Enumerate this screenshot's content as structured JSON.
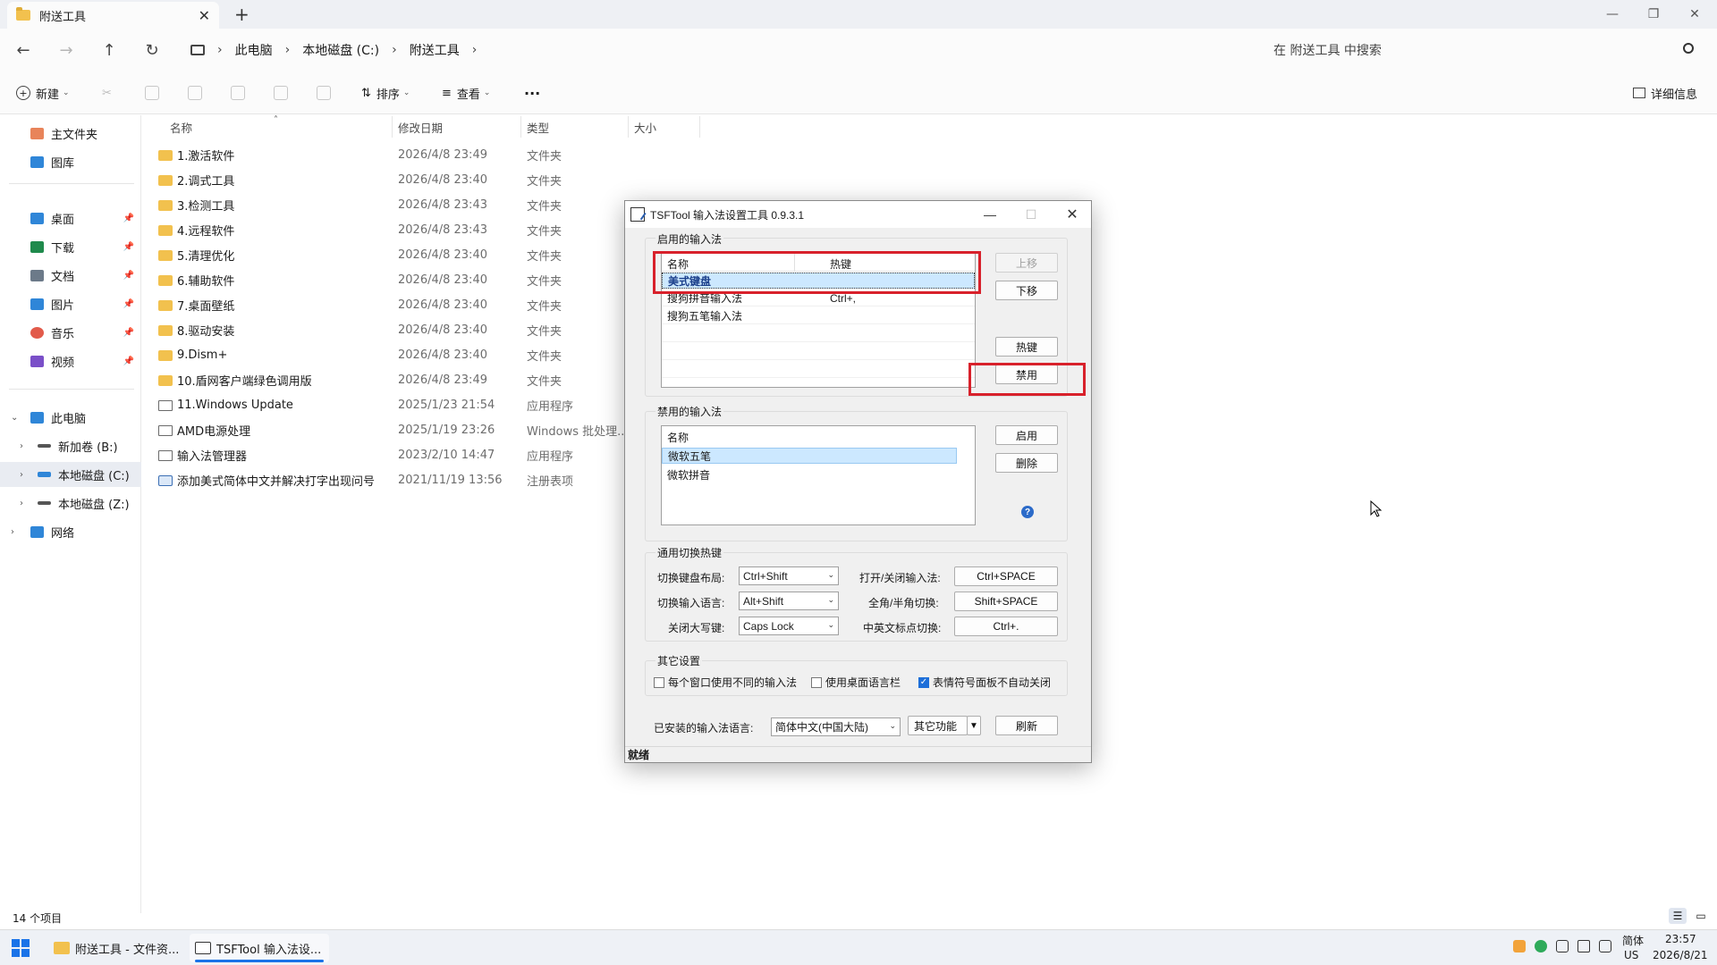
{
  "window": {
    "tab_title": "附送工具",
    "close_glyph": "✕",
    "new_tab_glyph": "+"
  },
  "nav": {
    "breadcrumb": [
      "此电脑",
      "本地磁盘 (C:)",
      "附送工具"
    ],
    "search_placeholder": "在 附送工具 中搜索"
  },
  "toolbar": {
    "new_label": "新建",
    "sort_label": "排序",
    "view_label": "查看",
    "more_label": "···",
    "details_label": "详细信息"
  },
  "sidebar": {
    "home": "主文件夹",
    "gallery": "图库",
    "quick": [
      {
        "label": "桌面",
        "icon": "desktop-icon",
        "color": "#2f86d8"
      },
      {
        "label": "下载",
        "icon": "download-icon",
        "color": "#1f8a4c"
      },
      {
        "label": "文档",
        "icon": "document-icon",
        "color": "#6c7a89"
      },
      {
        "label": "图片",
        "icon": "pictures-icon",
        "color": "#2f86d8"
      },
      {
        "label": "音乐",
        "icon": "music-icon",
        "color": "#e25b4b"
      },
      {
        "label": "视频",
        "icon": "video-icon",
        "color": "#7a4fc8"
      }
    ],
    "this_pc": "此电脑",
    "drives": [
      "新加卷 (B:)",
      "本地磁盘 (C:)",
      "本地磁盘 (Z:)"
    ],
    "network": "网络"
  },
  "columns": {
    "name": "名称",
    "modified": "修改日期",
    "type": "类型",
    "size": "大小"
  },
  "files": [
    {
      "name": "1.激活软件",
      "date": "2026/4/8 23:49",
      "type": "文件夹",
      "kind": "folder"
    },
    {
      "name": "2.调式工具",
      "date": "2026/4/8 23:40",
      "type": "文件夹",
      "kind": "folder"
    },
    {
      "name": "3.检测工具",
      "date": "2026/4/8 23:43",
      "type": "文件夹",
      "kind": "folder"
    },
    {
      "name": "4.远程软件",
      "date": "2026/4/8 23:43",
      "type": "文件夹",
      "kind": "folder"
    },
    {
      "name": "5.清理优化",
      "date": "2026/4/8 23:40",
      "type": "文件夹",
      "kind": "folder"
    },
    {
      "name": "6.辅助软件",
      "date": "2026/4/8 23:40",
      "type": "文件夹",
      "kind": "folder"
    },
    {
      "name": "7.桌面壁纸",
      "date": "2026/4/8 23:40",
      "type": "文件夹",
      "kind": "folder"
    },
    {
      "name": "8.驱动安装",
      "date": "2026/4/8 23:40",
      "type": "文件夹",
      "kind": "folder"
    },
    {
      "name": "9.Dism+",
      "date": "2026/4/8 23:40",
      "type": "文件夹",
      "kind": "folder"
    },
    {
      "name": "10.盾网客户端绿色调用版",
      "date": "2026/4/8 23:49",
      "type": "文件夹",
      "kind": "folder"
    },
    {
      "name": "11.Windows Update",
      "date": "2025/1/23 21:54",
      "type": "应用程序",
      "kind": "app"
    },
    {
      "name": "AMD电源处理",
      "date": "2025/1/19 23:26",
      "type": "Windows 批处理...",
      "kind": "app"
    },
    {
      "name": "输入法管理器",
      "date": "2023/2/10 14:47",
      "type": "应用程序",
      "kind": "app"
    },
    {
      "name": "添加美式简体中文并解决打字出现问号",
      "date": "2021/11/19 13:56",
      "type": "注册表项",
      "kind": "reg"
    }
  ],
  "status": {
    "item_count": "14 个项目"
  },
  "dialog": {
    "title": "TSFTool 输入法设置工具 0.9.3.1",
    "enabled_group": "启用的输入法",
    "enabled_cols": {
      "name": "名称",
      "hotkey": "热键"
    },
    "enabled_items": [
      {
        "name": "美式键盘",
        "hotkey": ""
      },
      {
        "name": "搜狗拼音输入法",
        "hotkey": "Ctrl+,"
      },
      {
        "name": "搜狗五笔输入法",
        "hotkey": ""
      }
    ],
    "btn_up": "上移",
    "btn_down": "下移",
    "btn_hotkey": "热键",
    "btn_disable": "禁用",
    "disabled_group": "禁用的输入法",
    "disabled_col": "名称",
    "disabled_items": [
      "微软五笔",
      "微软拼音"
    ],
    "btn_enable": "启用",
    "btn_delete": "删除",
    "help_glyph": "?",
    "hotkeys_group": "通用切换热键",
    "hk_layout_label": "切换键盘布局:",
    "hk_layout_value": "Ctrl+Shift",
    "hk_lang_label": "切换输入语言:",
    "hk_lang_value": "Alt+Shift",
    "hk_caps_label": "关闭大写键:",
    "hk_caps_value": "Caps Lock",
    "hk_toggle_label": "打开/关闭输入法:",
    "hk_toggle_value": "Ctrl+SPACE",
    "hk_width_label": "全角/半角切换:",
    "hk_width_value": "Shift+SPACE",
    "hk_punct_label": "中英文标点切换:",
    "hk_punct_value": "Ctrl+.",
    "other_group": "其它设置",
    "chk1": "每个窗口使用不同的输入法",
    "chk2": "使用桌面语言栏",
    "chk3": "表情符号面板不自动关闭",
    "installed_label": "已安装的输入法语言:",
    "installed_value": "简体中文(中国大陆)",
    "btn_other": "其它功能",
    "btn_refresh": "刷新",
    "status": "就绪"
  },
  "taskbar": {
    "explorer_label": "附送工具 - 文件资...",
    "tsf_label": "TSFTool 输入法设...",
    "ime_label": "简体",
    "ime_sub": "US",
    "time": "23:57",
    "date": "2026/8/21"
  },
  "colors": {
    "accent": "#1a73e8",
    "highlight_red": "#d8212b",
    "selection": "#cce8ff"
  }
}
